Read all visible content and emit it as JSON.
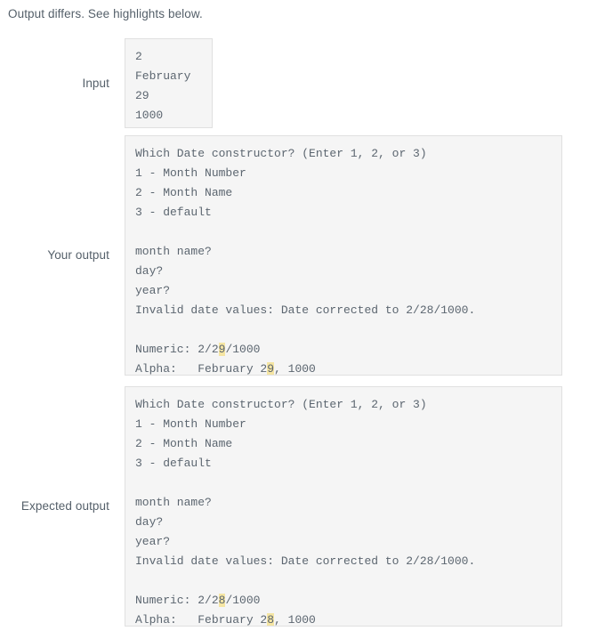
{
  "status": {
    "message": "Output differs. See highlights below."
  },
  "rows": {
    "input": {
      "label": "Input",
      "content": "2\nFebruary\n29\n1000"
    },
    "your_output": {
      "label": "Your output",
      "lines": [
        "Which Date constructor? (Enter 1, 2, or 3)",
        "1 - Month Number",
        "2 - Month Name",
        "3 - default",
        "",
        "month name?",
        "day?",
        "year?",
        "Invalid date values: Date corrected to 2/28/1000.",
        ""
      ],
      "numeric_prefix": "Numeric: 2/2",
      "numeric_highlight": "9",
      "numeric_suffix": "/1000",
      "alpha_prefix": "Alpha:   February 2",
      "alpha_highlight": "9",
      "alpha_suffix": ", 1000"
    },
    "expected_output": {
      "label": "Expected output",
      "lines": [
        "Which Date constructor? (Enter 1, 2, or 3)",
        "1 - Month Number",
        "2 - Month Name",
        "3 - default",
        "",
        "month name?",
        "day?",
        "year?",
        "Invalid date values: Date corrected to 2/28/1000.",
        ""
      ],
      "numeric_prefix": "Numeric: 2/2",
      "numeric_highlight": "8",
      "numeric_suffix": "/1000",
      "alpha_prefix": "Alpha:   February 2",
      "alpha_highlight": "8",
      "alpha_suffix": ", 1000"
    }
  },
  "colors": {
    "highlight": "#f5e5a3",
    "box_background": "#f5f5f5",
    "box_border": "#e0e0e0",
    "text": "#5c6670"
  }
}
